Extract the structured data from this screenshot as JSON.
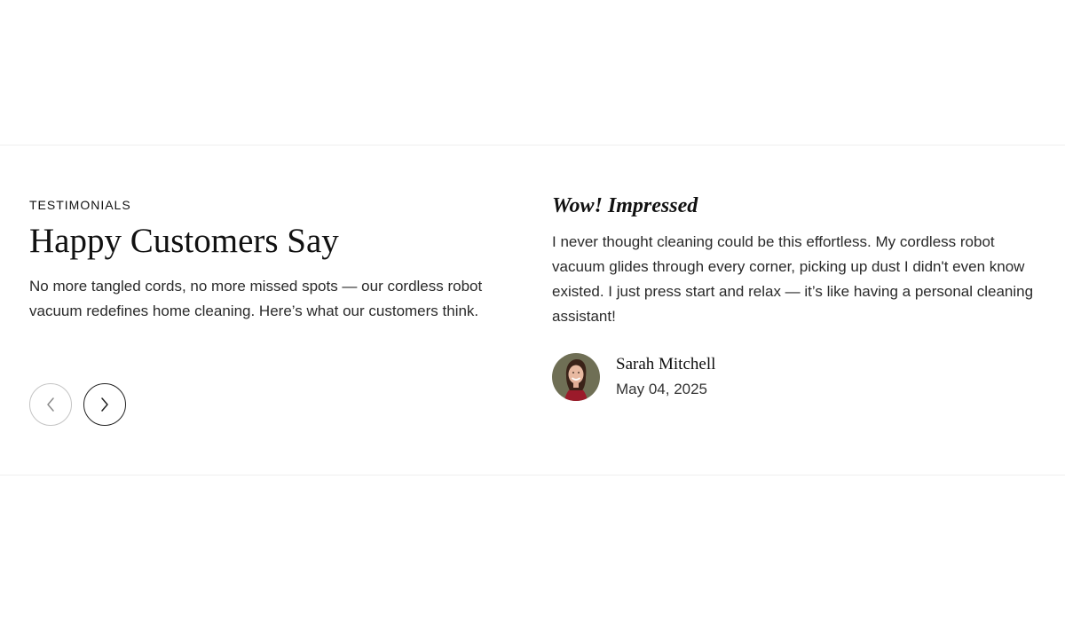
{
  "section": {
    "eyebrow": "TESTIMONIALS",
    "title": "Happy Customers Say",
    "intro": "No more tangled cords, no more missed spots — our cordless robot vacuum redefines home cleaning. Here’s what our customers think."
  },
  "navigation": {
    "prev_icon": "chevron-left-icon",
    "next_icon": "chevron-right-icon"
  },
  "testimonial": {
    "heading": "Wow! Impressed",
    "text": "I never thought cleaning could be this effortless. My cordless robot vacuum glides through every corner, picking up dust I didn't even know existed. I just press start and relax — it’s like having a personal cleaning assistant!",
    "author_name": "Sarah Mitchell",
    "date": "May 04, 2025"
  },
  "colors": {
    "text": "#1f1f1f",
    "divider": "#efefef",
    "prev_border": "#c4c4c4",
    "next_border": "#222222"
  }
}
